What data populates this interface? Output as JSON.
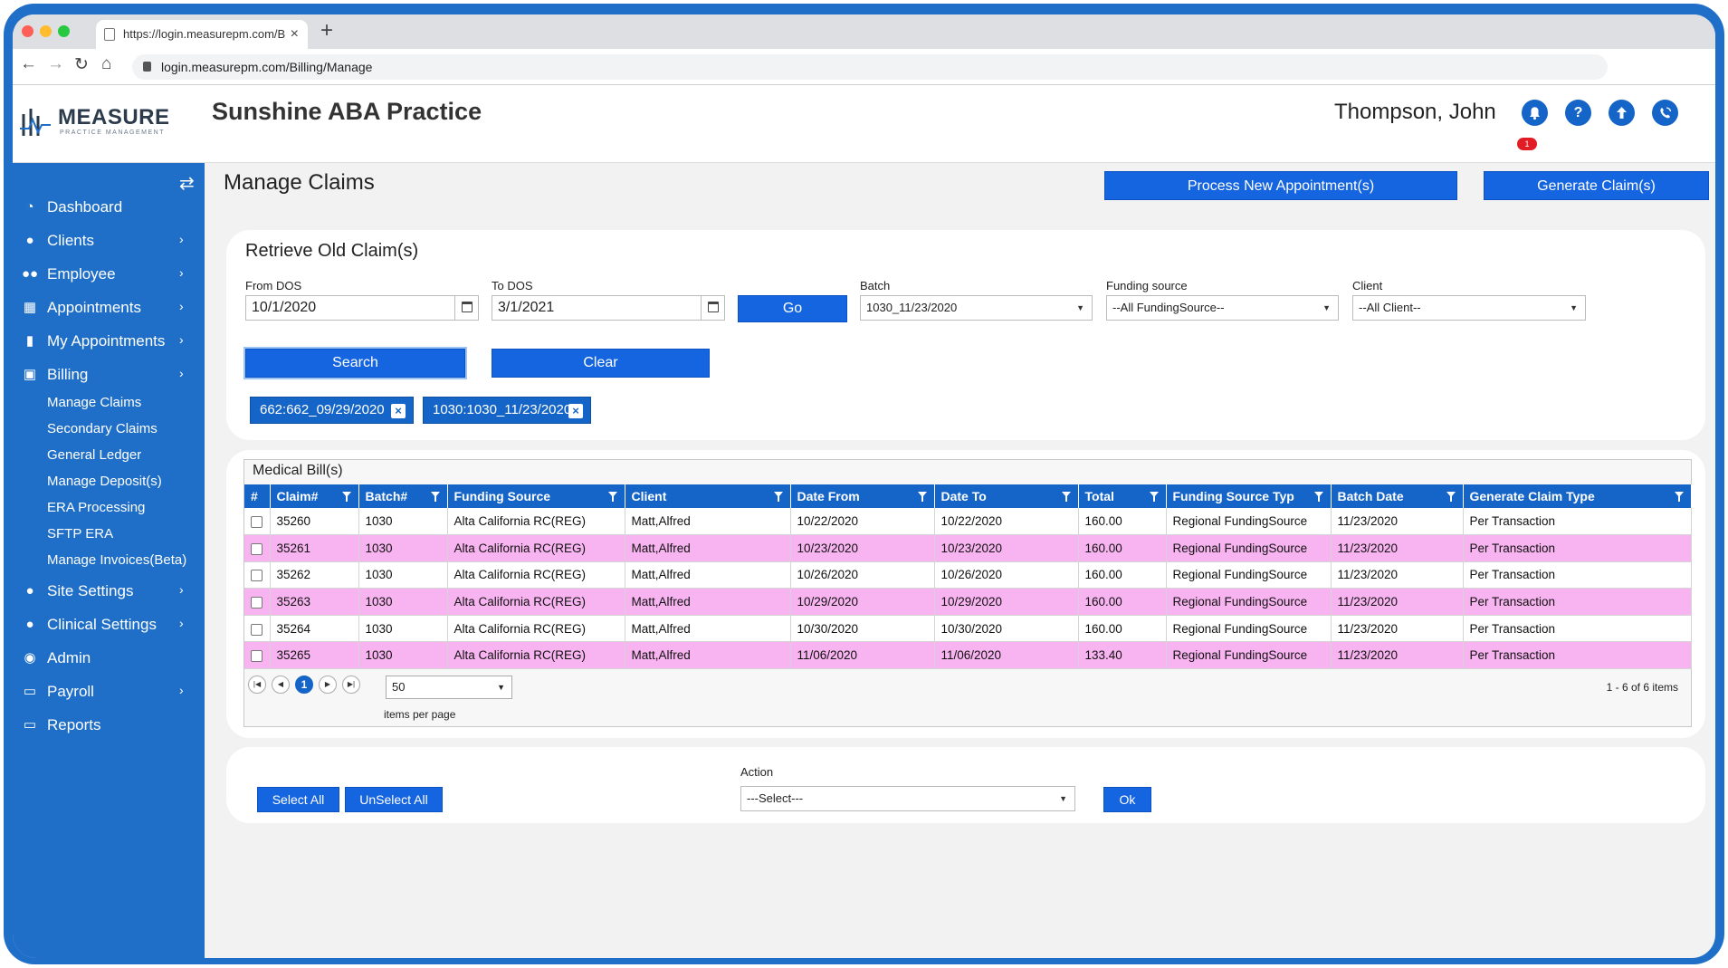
{
  "browser": {
    "tab_title": "https://login.measurepm.com/B",
    "url": "login.measurepm.com/Billing/Manage"
  },
  "header": {
    "logo_name": "MEASURE",
    "logo_sub": "PRACTICE MANAGEMENT",
    "practice": "Sunshine ABA Practice",
    "user": "Thompson, John",
    "notification_count": "1",
    "help_glyph": "?"
  },
  "sidebar": {
    "items": [
      {
        "label": "Dashboard",
        "icon": "dashboard-icon",
        "chevron": false
      },
      {
        "label": "Clients",
        "icon": "user-icon",
        "chevron": true
      },
      {
        "label": "Employee",
        "icon": "users-icon",
        "chevron": true
      },
      {
        "label": "Appointments",
        "icon": "calendar-icon",
        "chevron": true
      },
      {
        "label": "My Appointments",
        "icon": "book-icon",
        "chevron": true
      },
      {
        "label": "Billing",
        "icon": "money-icon",
        "chevron": true
      }
    ],
    "billing_sub": [
      "Manage Claims",
      "Secondary Claims",
      "General Ledger",
      "Manage Deposit(s)",
      "ERA Processing",
      "SFTP ERA",
      "Manage Invoices(Beta)"
    ],
    "items_after": [
      {
        "label": "Site Settings",
        "icon": "user-icon",
        "chevron": true
      },
      {
        "label": "Clinical Settings",
        "icon": "user-icon",
        "chevron": true
      },
      {
        "label": "Admin",
        "icon": "admin-icon",
        "chevron": false
      },
      {
        "label": "Payroll",
        "icon": "card-icon",
        "chevron": true
      },
      {
        "label": "Reports",
        "icon": "card-icon",
        "chevron": false
      }
    ]
  },
  "main": {
    "title": "Manage Claims",
    "process_button": "Process New Appointment(s)",
    "generate_button": "Generate Claim(s)"
  },
  "retrieve": {
    "title": "Retrieve Old Claim(s)",
    "from_label": "From DOS",
    "from_value": "10/1/2020",
    "to_label": "To DOS",
    "to_value": "3/1/2021",
    "go_button": "Go",
    "batch_label": "Batch",
    "batch_value": "1030_11/23/2020",
    "funding_label": "Funding source",
    "funding_value": "--All FundingSource--",
    "client_label": "Client",
    "client_value": "--All Client--",
    "search_button": "Search",
    "clear_button": "Clear",
    "chips": [
      "662:662_09/29/2020",
      "1030:1030_11/23/2020"
    ]
  },
  "grid": {
    "title": "Medical Bill(s)",
    "columns": [
      "#",
      "Claim#",
      "Batch#",
      "Funding Source",
      "Client",
      "Date From",
      "Date To",
      "Total",
      "Funding Source Typ",
      "Batch Date",
      "Generate Claim Type"
    ],
    "rows": [
      [
        "35260",
        "1030",
        "Alta California RC(REG)",
        "Matt,Alfred",
        "10/22/2020",
        "10/22/2020",
        "160.00",
        "Regional FundingSource",
        "11/23/2020",
        "Per Transaction"
      ],
      [
        "35261",
        "1030",
        "Alta California RC(REG)",
        "Matt,Alfred",
        "10/23/2020",
        "10/23/2020",
        "160.00",
        "Regional FundingSource",
        "11/23/2020",
        "Per Transaction"
      ],
      [
        "35262",
        "1030",
        "Alta California RC(REG)",
        "Matt,Alfred",
        "10/26/2020",
        "10/26/2020",
        "160.00",
        "Regional FundingSource",
        "11/23/2020",
        "Per Transaction"
      ],
      [
        "35263",
        "1030",
        "Alta California RC(REG)",
        "Matt,Alfred",
        "10/29/2020",
        "10/29/2020",
        "160.00",
        "Regional FundingSource",
        "11/23/2020",
        "Per Transaction"
      ],
      [
        "35264",
        "1030",
        "Alta California RC(REG)",
        "Matt,Alfred",
        "10/30/2020",
        "10/30/2020",
        "160.00",
        "Regional FundingSource",
        "11/23/2020",
        "Per Transaction"
      ],
      [
        "35265",
        "1030",
        "Alta California RC(REG)",
        "Matt,Alfred",
        "11/06/2020",
        "11/06/2020",
        "133.40",
        "Regional FundingSource",
        "11/23/2020",
        "Per Transaction"
      ]
    ],
    "page": "1",
    "page_size": "50",
    "page_size_label": "items per page",
    "info": "1 - 6 of 6 items"
  },
  "actions": {
    "select_all": "Select All",
    "unselect_all": "UnSelect All",
    "action_label": "Action",
    "action_value": "---Select---",
    "ok_button": "Ok"
  },
  "colors": {
    "brand_blue": "#1f6fc9",
    "button_blue": "#1565e0",
    "row_highlight": "#f8b4f0",
    "badge_red": "#e11c24"
  }
}
